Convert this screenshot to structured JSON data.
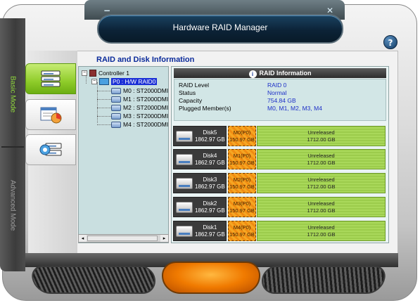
{
  "window": {
    "title": "Hardware RAID Manager",
    "minimize_glyph": "−",
    "close_glyph": "✕",
    "help_glyph": "?"
  },
  "modes": {
    "basic": "Basic Mode",
    "advanced": "Advanced Mode"
  },
  "tabs": [
    {
      "icon": "raid-disks-icon",
      "active": true
    },
    {
      "icon": "disk-chart-icon",
      "active": false
    },
    {
      "icon": "settings-disk-icon",
      "active": false
    }
  ],
  "section_title": "RAID and Disk Information",
  "tree": {
    "controller": "Controller 1",
    "raid": "P0 : H/W RAID0",
    "members": [
      "M0 : ST2000DMI",
      "M1 : ST2000DMI",
      "M2 : ST2000DMI",
      "M3 : ST2000DMI",
      "M4 : ST2000DMI"
    ]
  },
  "raid_info": {
    "header": "RAID Information",
    "info_glyph": "i",
    "rows": [
      {
        "label": "RAID Level",
        "value": "RAID 0"
      },
      {
        "label": "Status",
        "value": "Normal"
      },
      {
        "label": "Capacity",
        "value": "754.84 GB"
      },
      {
        "label": "Plugged Member(s)",
        "value": "M0, M1, M2, M3, M4"
      }
    ]
  },
  "disks": [
    {
      "name": "Disk5",
      "size": "1862.97 GB",
      "member": "M0(P0)",
      "member_size": "150.97 GB",
      "free_label": "Unreleased",
      "free_size": "1712.00 GB"
    },
    {
      "name": "Disk4",
      "size": "1862.97 GB",
      "member": "M1(P0)",
      "member_size": "150.97 GB",
      "free_label": "Unreleased",
      "free_size": "1712.00 GB"
    },
    {
      "name": "Disk3",
      "size": "1862.97 GB",
      "member": "M2(P0)",
      "member_size": "150.97 GB",
      "free_label": "Unreleased",
      "free_size": "1712.00 GB"
    },
    {
      "name": "Disk2",
      "size": "1862.97 GB",
      "member": "M3(P0)",
      "member_size": "150.97 GB",
      "free_label": "Unreleased",
      "free_size": "1712.00 GB"
    },
    {
      "name": "Disk1",
      "size": "1862.97 GB",
      "member": "M4(P0)",
      "member_size": "150.97 GB",
      "free_label": "Unreleased",
      "free_size": "1712.00 GB"
    }
  ],
  "scroll": {
    "left_glyph": "◂",
    "right_glyph": "▸"
  },
  "colors": {
    "accent_green": "#8fcc2a",
    "member_orange": "#f5a623",
    "unreleased_green": "#a9d85a",
    "title_navy": "#0c2337",
    "value_blue": "#1d2fc7"
  }
}
